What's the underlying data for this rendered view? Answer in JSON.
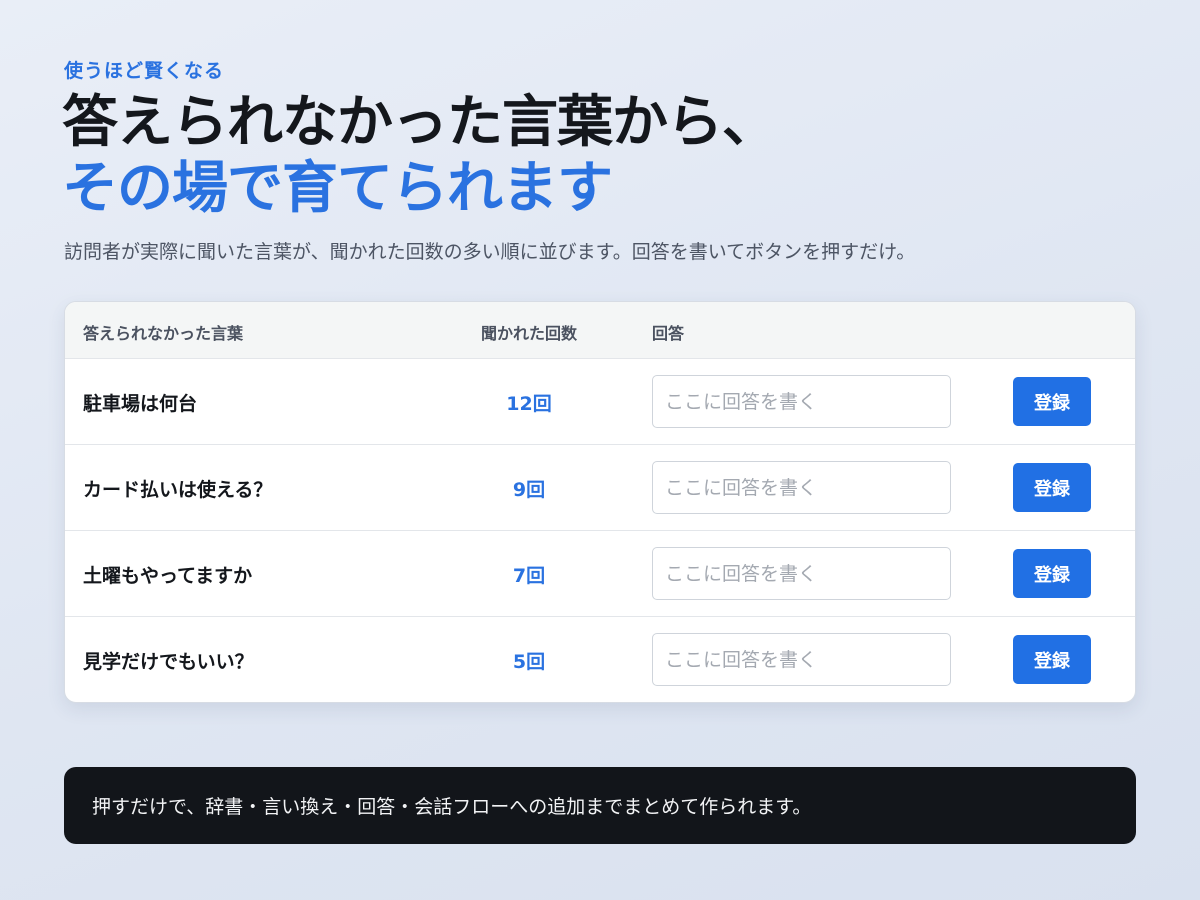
{
  "eyebrow": "使うほど賢くなる",
  "headline": {
    "line1": "答えられなかった言葉から、",
    "line2": "その場で育てられます"
  },
  "lead": "訪問者が実際に聞いた言葉が、聞かれた回数の多い順に並びます。回答を書いてボタンを押すだけ。",
  "table": {
    "headers": {
      "word": "答えられなかった言葉",
      "count": "聞かれた回数",
      "answer": "回答"
    },
    "rows": [
      {
        "word": "駐車場は何台",
        "count": "12回",
        "placeholder": "ここに回答を書く",
        "button": "登録"
      },
      {
        "word": "カード払いは使える？",
        "count": "9回",
        "placeholder": "ここに回答を書く",
        "button": "登録"
      },
      {
        "word": "土曜もやってますか",
        "count": "7回",
        "placeholder": "ここに回答を書く",
        "button": "登録"
      },
      {
        "word": "見学だけでもいい？",
        "count": "5回",
        "placeholder": "ここに回答を書く",
        "button": "登録"
      }
    ]
  },
  "footer": "押すだけで、辞書・言い換え・回答・会話フローへの追加までまとめて作られます。",
  "colors": {
    "accent": "#2a72e0",
    "button": "#2170e4",
    "footer_bg": "#12151a"
  }
}
